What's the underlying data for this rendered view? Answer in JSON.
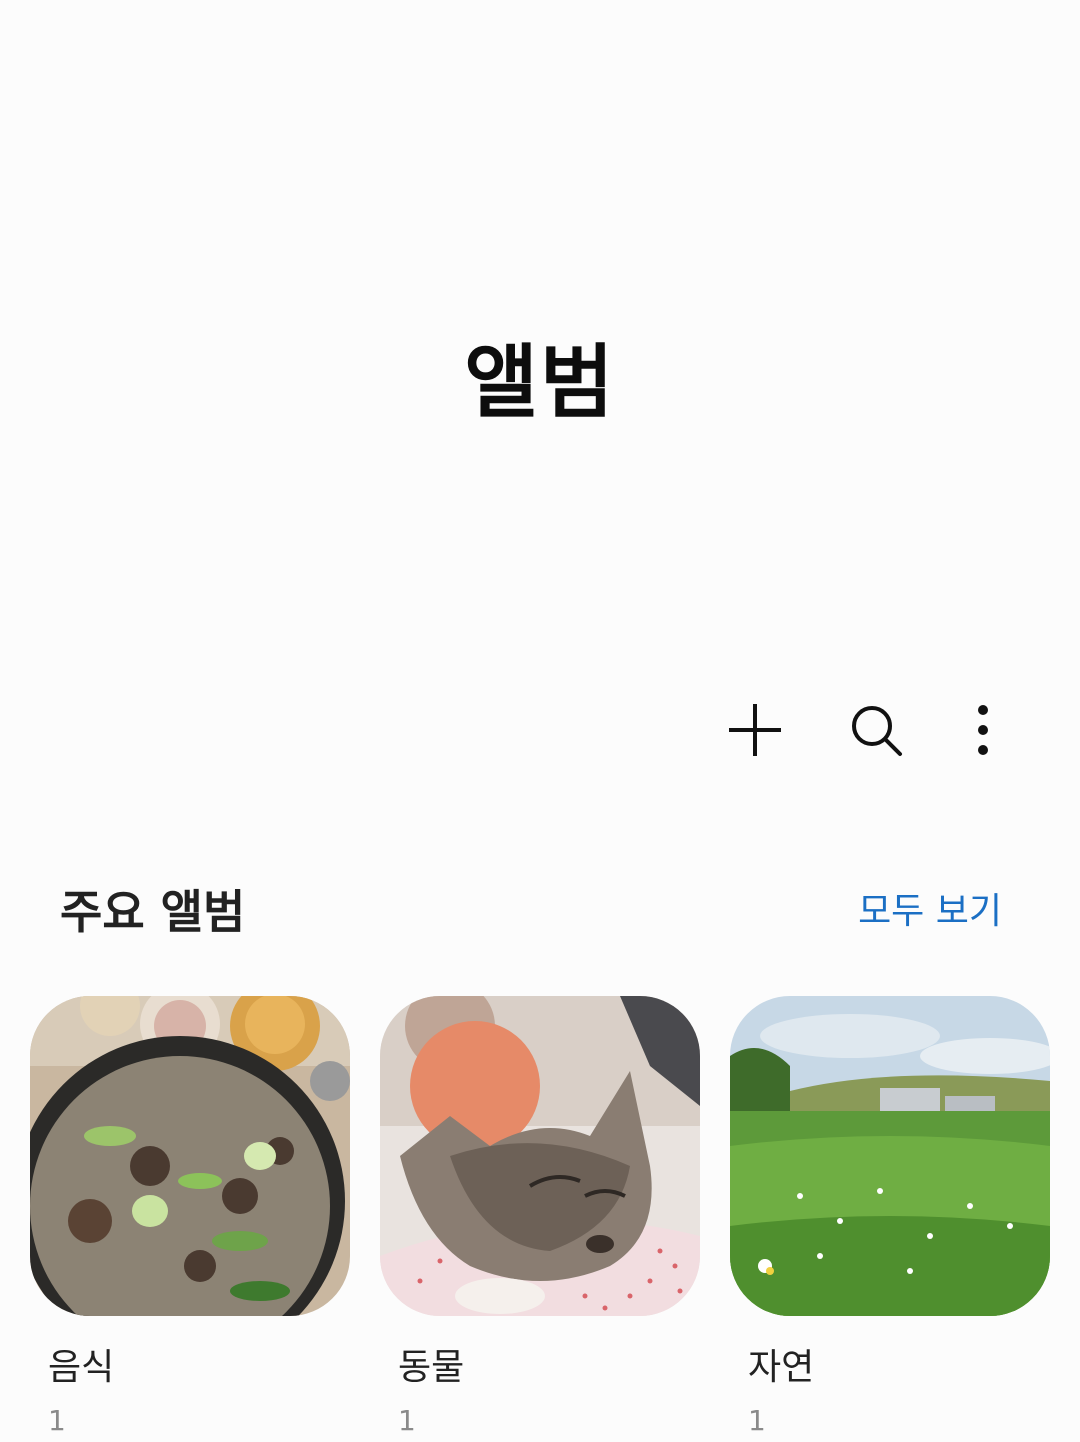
{
  "header": {
    "title": "앨범"
  },
  "actions": [
    {
      "icon": "plus-icon"
    },
    {
      "icon": "search-icon"
    },
    {
      "icon": "more-vertical-icon"
    }
  ],
  "featured": {
    "title": "주요 앨범",
    "view_all": "모두 보기",
    "albums": [
      {
        "name": "음식",
        "count": "1"
      },
      {
        "name": "동물",
        "count": "1"
      },
      {
        "name": "자연",
        "count": "1"
      }
    ]
  },
  "colors": {
    "accent": "#1b6fc4",
    "background": "#fcfcfc"
  }
}
